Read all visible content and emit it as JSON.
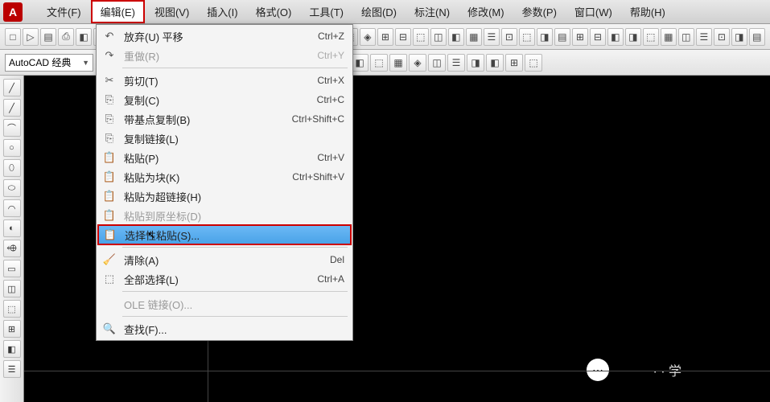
{
  "app": {
    "logo_text": "A"
  },
  "menubar": [
    {
      "label": "文件(F)"
    },
    {
      "label": "编辑(E)",
      "active": true
    },
    {
      "label": "视图(V)"
    },
    {
      "label": "插入(I)"
    },
    {
      "label": "格式(O)"
    },
    {
      "label": "工具(T)"
    },
    {
      "label": "绘图(D)"
    },
    {
      "label": "标注(N)"
    },
    {
      "label": "修改(M)"
    },
    {
      "label": "参数(P)"
    },
    {
      "label": "窗口(W)"
    },
    {
      "label": "帮助(H)"
    }
  ],
  "workspace": {
    "label": "AutoCAD 经典"
  },
  "context_menu": {
    "items": [
      {
        "icon": "↶",
        "label": "放弃(U) 平移",
        "shortcut": "Ctrl+Z"
      },
      {
        "icon": "↷",
        "label": "重做(R)",
        "shortcut": "Ctrl+Y",
        "disabled": true
      },
      {
        "sep": true
      },
      {
        "icon": "✂",
        "label": "剪切(T)",
        "shortcut": "Ctrl+X"
      },
      {
        "icon": "⎘",
        "label": "复制(C)",
        "shortcut": "Ctrl+C"
      },
      {
        "icon": "⎘",
        "label": "带基点复制(B)",
        "shortcut": "Ctrl+Shift+C"
      },
      {
        "icon": "⎘",
        "label": "复制链接(L)",
        "shortcut": ""
      },
      {
        "icon": "📋",
        "label": "粘贴(P)",
        "shortcut": "Ctrl+V"
      },
      {
        "icon": "📋",
        "label": "粘贴为块(K)",
        "shortcut": "Ctrl+Shift+V"
      },
      {
        "icon": "📋",
        "label": "粘贴为超链接(H)",
        "shortcut": ""
      },
      {
        "icon": "📋",
        "label": "粘贴到原坐标(D)",
        "shortcut": "",
        "disabled": true
      },
      {
        "icon": "📋",
        "label": "选择性粘贴(S)...",
        "shortcut": "",
        "highlighted": true,
        "cursor": true
      },
      {
        "sep": true
      },
      {
        "icon": "🧹",
        "label": "清除(A)",
        "shortcut": "Del"
      },
      {
        "icon": "⬚",
        "label": "全部选择(L)",
        "shortcut": "Ctrl+A"
      },
      {
        "sep": true
      },
      {
        "icon": "",
        "label": "OLE 链接(O)...",
        "shortcut": "",
        "disabled": true
      },
      {
        "sep": true
      },
      {
        "icon": "🔍",
        "label": "查找(F)...",
        "shortcut": ""
      }
    ]
  },
  "toolbar1_icons": [
    "□",
    "▷",
    "▤",
    "⎙",
    "◧",
    "⤢",
    "✂",
    "⎘",
    "📋",
    "⚲"
  ],
  "toolbar1_icons_right": [
    "⬚",
    "◈",
    "⊞",
    "⊟",
    "⬚",
    "◫",
    "◧",
    "▦",
    "☰",
    "⊡",
    "⬚",
    "◨",
    "▤",
    "⊞",
    "⊟",
    "◧",
    "◨",
    "⬚",
    "▦",
    "◫",
    "☰",
    "⊡",
    "◨",
    "▤"
  ],
  "toolbar2_icons": [
    "⬚",
    "⊡",
    "◧",
    "⬚",
    "▦",
    "◈",
    "◫",
    "☰",
    "◨",
    "◧",
    "⊞",
    "⬚"
  ],
  "left_tools": [
    "╱",
    "╱",
    "⌒",
    "○",
    "⬯",
    "⬭",
    "◠",
    "◐",
    "⬲",
    "▭",
    "◫",
    "⬚",
    "⊞",
    "◧",
    "☰"
  ],
  "watermark": {
    "symbol": "⋯",
    "text": "· · 学"
  }
}
